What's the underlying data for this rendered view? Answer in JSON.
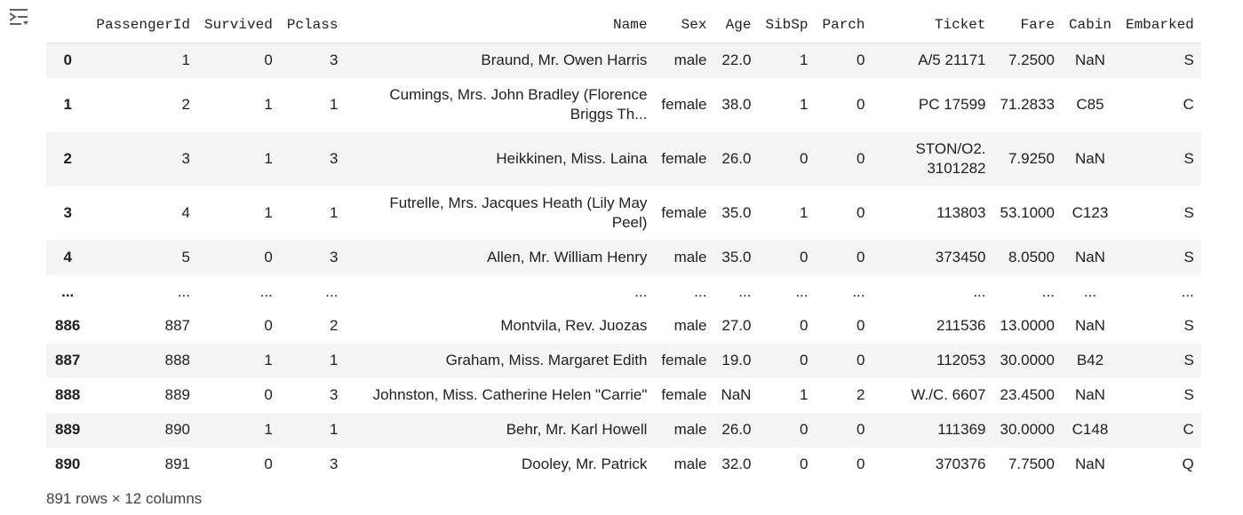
{
  "toolbar": {
    "output_icon": "output-settings-icon"
  },
  "table": {
    "index_header": "",
    "columns": [
      "PassengerId",
      "Survived",
      "Pclass",
      "Name",
      "Sex",
      "Age",
      "SibSp",
      "Parch",
      "Ticket",
      "Fare",
      "Cabin",
      "Embarked"
    ],
    "rows": [
      {
        "index": "0",
        "cells": [
          "1",
          "0",
          "3",
          "Braund, Mr. Owen Harris",
          "male",
          "22.0",
          "1",
          "0",
          "A/5 21171",
          "7.2500",
          "NaN",
          "S"
        ]
      },
      {
        "index": "1",
        "cells": [
          "2",
          "1",
          "1",
          "Cumings, Mrs. John Bradley (Florence Briggs Th...",
          "female",
          "38.0",
          "1",
          "0",
          "PC 17599",
          "71.2833",
          "C85",
          "C"
        ]
      },
      {
        "index": "2",
        "cells": [
          "3",
          "1",
          "3",
          "Heikkinen, Miss. Laina",
          "female",
          "26.0",
          "0",
          "0",
          "STON/O2. 3101282",
          "7.9250",
          "NaN",
          "S"
        ]
      },
      {
        "index": "3",
        "cells": [
          "4",
          "1",
          "1",
          "Futrelle, Mrs. Jacques Heath (Lily May Peel)",
          "female",
          "35.0",
          "1",
          "0",
          "113803",
          "53.1000",
          "C123",
          "S"
        ]
      },
      {
        "index": "4",
        "cells": [
          "5",
          "0",
          "3",
          "Allen, Mr. William Henry",
          "male",
          "35.0",
          "0",
          "0",
          "373450",
          "8.0500",
          "NaN",
          "S"
        ]
      },
      {
        "index": "...",
        "cells": [
          "...",
          "...",
          "...",
          "...",
          "...",
          "...",
          "...",
          "...",
          "...",
          "...",
          "...",
          "..."
        ]
      },
      {
        "index": "886",
        "cells": [
          "887",
          "0",
          "2",
          "Montvila, Rev. Juozas",
          "male",
          "27.0",
          "0",
          "0",
          "211536",
          "13.0000",
          "NaN",
          "S"
        ]
      },
      {
        "index": "887",
        "cells": [
          "888",
          "1",
          "1",
          "Graham, Miss. Margaret Edith",
          "female",
          "19.0",
          "0",
          "0",
          "112053",
          "30.0000",
          "B42",
          "S"
        ]
      },
      {
        "index": "888",
        "cells": [
          "889",
          "0",
          "3",
          "Johnston, Miss. Catherine Helen \"Carrie\"",
          "female",
          "NaN",
          "1",
          "2",
          "W./C. 6607",
          "23.4500",
          "NaN",
          "S"
        ]
      },
      {
        "index": "889",
        "cells": [
          "890",
          "1",
          "1",
          "Behr, Mr. Karl Howell",
          "male",
          "26.0",
          "0",
          "0",
          "111369",
          "30.0000",
          "C148",
          "C"
        ]
      },
      {
        "index": "890",
        "cells": [
          "891",
          "0",
          "3",
          "Dooley, Mr. Patrick",
          "male",
          "32.0",
          "0",
          "0",
          "370376",
          "7.7500",
          "NaN",
          "Q"
        ]
      }
    ]
  },
  "footer": {
    "summary": "891 rows × 12 columns"
  }
}
